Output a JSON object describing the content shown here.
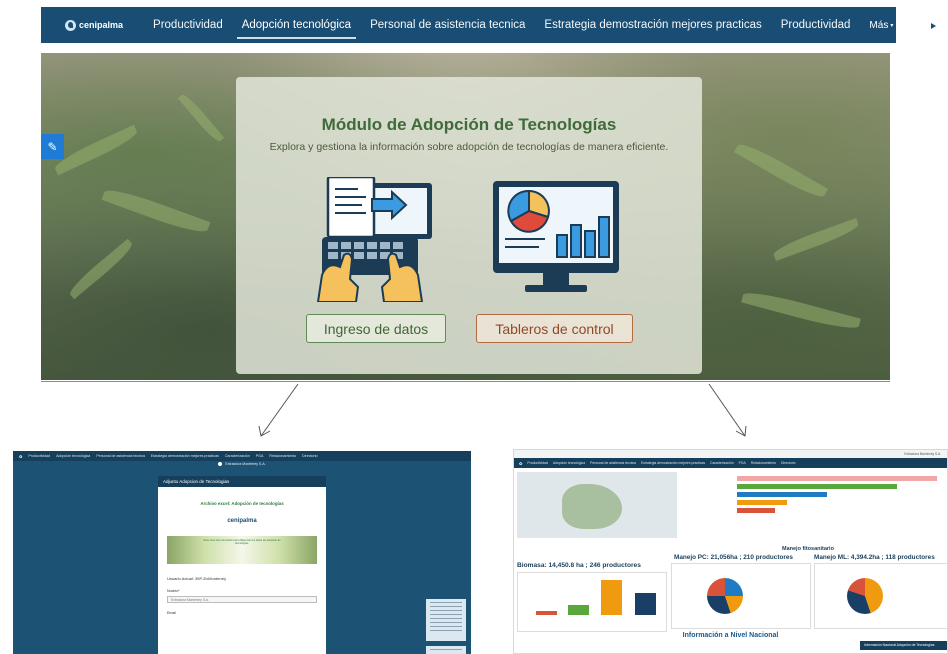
{
  "navbar": {
    "logo_text": "cenipalma",
    "items": [
      {
        "label": "Productividad",
        "active": false
      },
      {
        "label": "Adopción tecnológica",
        "active": true
      },
      {
        "label": "Personal de asistencia tecnica",
        "active": false
      },
      {
        "label": "Estrategia demostración mejores practicas",
        "active": false
      },
      {
        "label": "Productividad",
        "active": false
      }
    ],
    "more_label": "Más",
    "social": [
      "youtube-icon",
      "twitter-icon"
    ]
  },
  "hero": {
    "title": "Módulo de Adopción de Tecnologías",
    "subtitle": "Explora y gestiona la información sobre adopción de tecnologías de manera eficiente.",
    "btn_ingreso": "Ingreso de datos",
    "btn_tableros": "Tableros de control",
    "edit_icon": "pencil-icon"
  },
  "left_preview": {
    "nav_items": [
      "Productividad",
      "Adopción tecnológica",
      "Personal de asistencia tecnica",
      "Estrategia demostración mejores practicas",
      "Caracterización",
      "PGA",
      "Relacionamiento",
      "Directorio"
    ],
    "user_menu": "Extractora Monterrey S.A.",
    "form_header": "Adjunto Adopcion de Tecnologias",
    "form_title": "Archivo excel: Adopción de tecnologías",
    "form_logo": "cenipalma",
    "banner_text": "Nota: Use este formulario para diligenciar los datos de adopción de tecnologías.",
    "user_line": "Usuario Actual: 35P-ExMonterrey",
    "field_nucleo_label": "Nucleo*",
    "field_nucleo_value": "Extractora Monterrey S.A.",
    "field_email_label": "Email"
  },
  "right_preview": {
    "user_menu": "Extractora Monterrey S.A.",
    "nav_items": [
      "Productividad",
      "Adopción tecnológica",
      "Personal de asistencia tecnica",
      "Estrategia demostración mejores practicas",
      "Caracterización",
      "PGA",
      "Relacionamiento",
      "Directorio"
    ],
    "biomasa": "Biomasa: 14,450.8 ha ; 246 productores",
    "manejo_title": "Manejo fitosanitario",
    "manejo_pc": "Manejo PC: 21,056ha ; 210 productores",
    "manejo_ml": "Manejo ML: 4,394.2ha ; 118 productores",
    "footer_title": "Información a Nivel Nacional",
    "nacional_badge": "Información Nacional  Adopción de Tecnologías",
    "colors": {
      "orange": "#f09a10",
      "green": "#5aa83b",
      "blue": "#1f7bc4",
      "red": "#d8533a",
      "navy": "#1a3f66",
      "pink": "#f2a6a6"
    }
  }
}
